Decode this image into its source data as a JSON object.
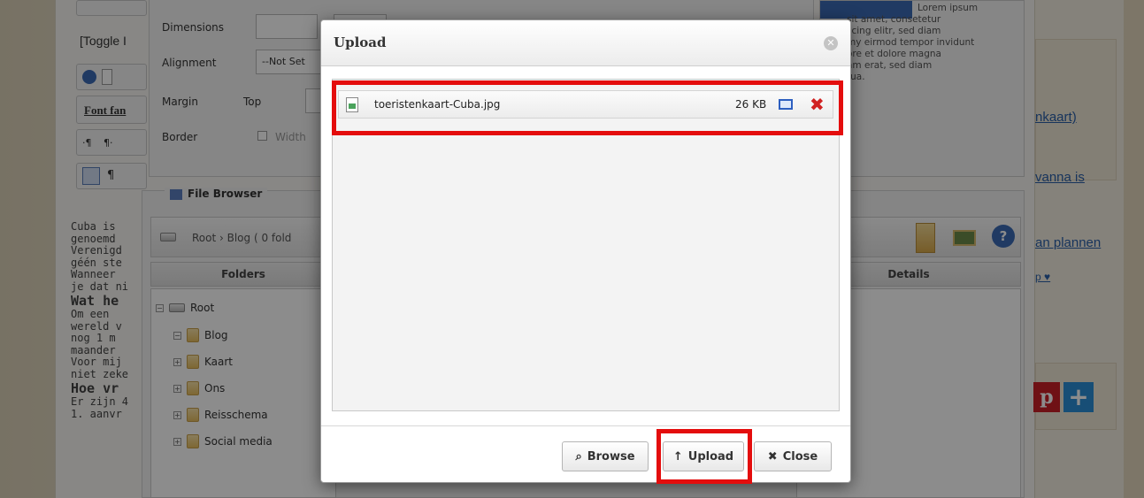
{
  "background": {
    "toggle_label": "[Toggle I",
    "font_family_label": "Font fan",
    "image_props": {
      "dimensions_label": "Dimensions",
      "alignment_label": "Alignment",
      "alignment_value": "--Not Set",
      "margin_label": "Margin",
      "margin_top_label": "Top",
      "border_label": "Border",
      "border_width_label": "Width"
    },
    "preview_text": [
      "Lorem ipsum",
      "sit amet, consetetur",
      "scing elitr, sed diam",
      "my eirmod tempor invidunt",
      "ore et dolore magna",
      "am erat, sed diam",
      "tua."
    ],
    "file_browser": {
      "legend": "File Browser",
      "path": "Root › Blog   ( 0 fold",
      "folders_header": "Folders",
      "details_header": "Details",
      "tree": [
        {
          "name": "Root"
        },
        {
          "name": "Blog"
        },
        {
          "name": "Kaart"
        },
        {
          "name": "Ons"
        },
        {
          "name": "Reisschema"
        },
        {
          "name": "Social media"
        }
      ]
    },
    "editor_text": [
      "Cuba is",
      "genoemd",
      "Verenigd",
      "géén ste",
      "Wanneer",
      "je dat ni",
      "Wat he",
      "Om een",
      "wereld v",
      "nog 1 m",
      "maander",
      "Voor mij",
      "niet zeke",
      "Hoe vr",
      "Er zijn 4",
      "1. aanvr"
    ],
    "sidebar_links": [
      "nkaart)",
      "vanna is",
      "an plannen",
      "p ♥"
    ]
  },
  "modal": {
    "title": "Upload",
    "file": {
      "name": "toeristenkaart-Cuba.jpg",
      "size": "26 KB"
    },
    "buttons": {
      "browse": "Browse",
      "upload": "Upload",
      "close": "Close"
    }
  },
  "highlight_color": "#e40d0d"
}
